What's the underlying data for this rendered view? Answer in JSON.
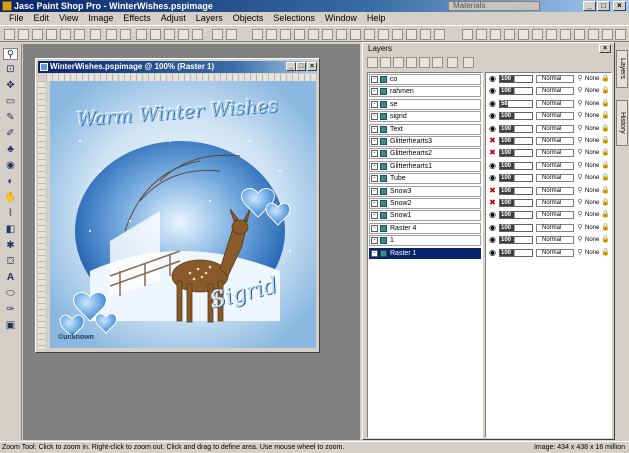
{
  "app": {
    "title": "Jasc Paint Shop Pro - WinterWishes.pspimage",
    "materials_label": "Materials"
  },
  "menu": [
    "File",
    "Edit",
    "View",
    "Image",
    "Effects",
    "Adjust",
    "Layers",
    "Objects",
    "Selections",
    "Window",
    "Help"
  ],
  "image_window": {
    "title": "WinterWishes.pspimage @ 100% (Raster 1)",
    "canvas_title": "Warm Winter Wishes",
    "signature": "Sigrid",
    "credit": "©unknown"
  },
  "layers_palette": {
    "title": "Layers",
    "layers": [
      {
        "name": "co",
        "opacity": "100",
        "blend": "Normal",
        "link": "None",
        "visible": true,
        "selected": false
      },
      {
        "name": "rahmen",
        "opacity": "100",
        "blend": "Normal",
        "link": "None",
        "visible": true,
        "selected": false
      },
      {
        "name": "se",
        "opacity": "58",
        "blend": "Normal",
        "link": "None",
        "visible": true,
        "selected": false
      },
      {
        "name": "sigrid",
        "opacity": "100",
        "blend": "Normal",
        "link": "None",
        "visible": true,
        "selected": false
      },
      {
        "name": "Text",
        "opacity": "100",
        "blend": "Normal",
        "link": "None",
        "visible": true,
        "selected": false
      },
      {
        "name": "Glitterhearts3",
        "opacity": "100",
        "blend": "Normal",
        "link": "None",
        "visible": false,
        "selected": false
      },
      {
        "name": "Glitterhearts2",
        "opacity": "100",
        "blend": "Normal",
        "link": "None",
        "visible": false,
        "selected": false
      },
      {
        "name": "Glitterhearts1",
        "opacity": "100",
        "blend": "Normal",
        "link": "None",
        "visible": true,
        "selected": false
      },
      {
        "name": "Tube",
        "opacity": "100",
        "blend": "Normal",
        "link": "None",
        "visible": true,
        "selected": false
      },
      {
        "name": "Snow3",
        "opacity": "100",
        "blend": "Normal",
        "link": "None",
        "visible": false,
        "selected": false
      },
      {
        "name": "Snow2",
        "opacity": "100",
        "blend": "Normal",
        "link": "None",
        "visible": false,
        "selected": false
      },
      {
        "name": "Snow1",
        "opacity": "100",
        "blend": "Normal",
        "link": "None",
        "visible": true,
        "selected": false
      },
      {
        "name": "Raster 4",
        "opacity": "100",
        "blend": "Normal",
        "link": "None",
        "visible": true,
        "selected": false
      },
      {
        "name": "1",
        "opacity": "100",
        "blend": "Normal",
        "link": "None",
        "visible": true,
        "selected": false
      },
      {
        "name": "Raster 1",
        "opacity": "100",
        "blend": "Normal",
        "link": "None",
        "visible": true,
        "selected": true
      }
    ]
  },
  "right_tabs": {
    "layers": "Layers",
    "history": "History"
  },
  "status": {
    "left": "Zoom Tool: Click to zoom in. Right-click to zoom out. Click and drag to define area. Use mouse wheel to zoom.",
    "right": "Image: 434 x 438 x 16 million"
  },
  "colors": {
    "titlebar_start": "#0a246a",
    "titlebar_end": "#a6caf0",
    "selected_row": "#0a246a",
    "workspace": "#808080"
  }
}
